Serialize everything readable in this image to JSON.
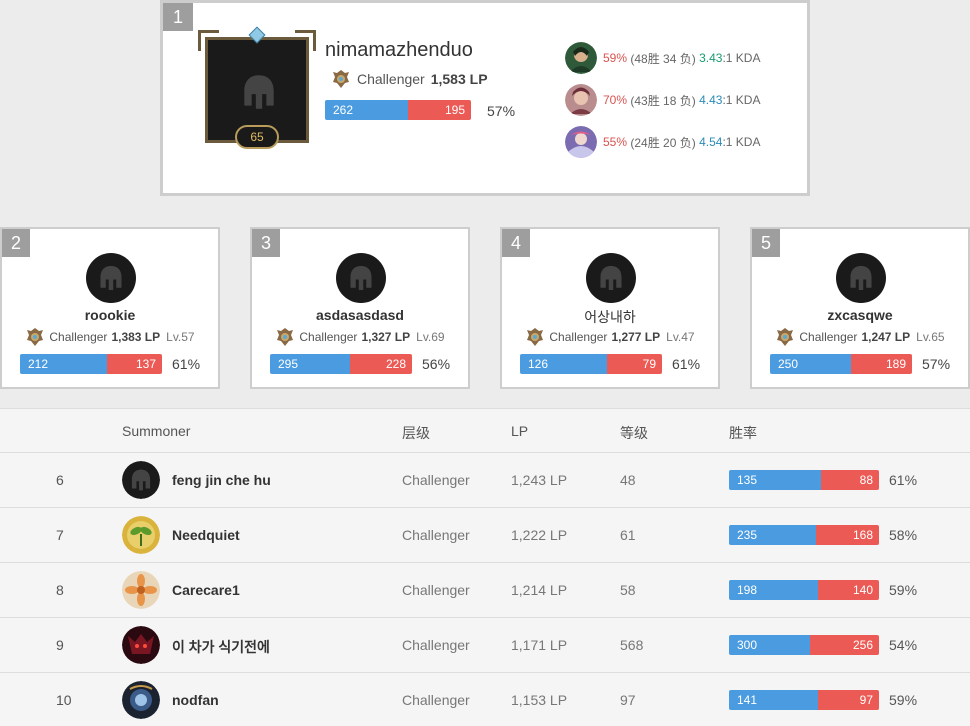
{
  "top": {
    "rank": "1",
    "name": "nimamazhenduo",
    "tier": "Challenger",
    "lp": "1,583 LP",
    "level": "65",
    "wins": "262",
    "losses": "195",
    "win_fraction": 0.57,
    "win_rate": "57%",
    "champions": [
      {
        "wr": "59%",
        "record": "(48胜 34 负)",
        "kda_num": "3.43",
        "kda_suffix": ":1 KDA",
        "kda_color": "#1a9c6b"
      },
      {
        "wr": "70%",
        "record": "(43胜 18 负)",
        "kda_num": "4.43",
        "kda_suffix": ":1 KDA",
        "kda_color": "#2a8ab8"
      },
      {
        "wr": "55%",
        "record": "(24胜 20 负)",
        "kda_num": "4.54",
        "kda_suffix": ":1 KDA",
        "kda_color": "#2a8ab8"
      }
    ]
  },
  "cards": [
    {
      "rank": "2",
      "name": "roookie",
      "tier": "Challenger",
      "lp": "1,383 LP",
      "lv": "Lv.57",
      "wins": "212",
      "losses": "137",
      "win_fraction": 0.61,
      "win_rate": "61%"
    },
    {
      "rank": "3",
      "name": "asdasasdasd",
      "tier": "Challenger",
      "lp": "1,327 LP",
      "lv": "Lv.69",
      "wins": "295",
      "losses": "228",
      "win_fraction": 0.56,
      "win_rate": "56%"
    },
    {
      "rank": "4",
      "name": "어상내하",
      "tier": "Challenger",
      "lp": "1,277 LP",
      "lv": "Lv.47",
      "wins": "126",
      "losses": "79",
      "win_fraction": 0.61,
      "win_rate": "61%"
    },
    {
      "rank": "5",
      "name": "zxcasqwe",
      "tier": "Challenger",
      "lp": "1,247 LP",
      "lv": "Lv.65",
      "wins": "250",
      "losses": "189",
      "win_fraction": 0.57,
      "win_rate": "57%"
    }
  ],
  "table": {
    "headers": {
      "summoner": "Summoner",
      "tier": "层级",
      "lp": "LP",
      "level": "等级",
      "winrate": "胜率"
    },
    "rows": [
      {
        "rank": "6",
        "name": "feng jin che hu",
        "tier": "Challenger",
        "lp": "1,243 LP",
        "level": "48",
        "wins": "135",
        "losses": "88",
        "win_fraction": 0.61,
        "win_rate": "61%",
        "avatar": "helmet-icon"
      },
      {
        "rank": "7",
        "name": "Needquiet",
        "tier": "Challenger",
        "lp": "1,222 LP",
        "level": "61",
        "wins": "235",
        "losses": "168",
        "win_fraction": 0.58,
        "win_rate": "58%",
        "avatar": "sprout-icon"
      },
      {
        "rank": "8",
        "name": "Carecare1",
        "tier": "Challenger",
        "lp": "1,214 LP",
        "level": "58",
        "wins": "198",
        "losses": "140",
        "win_fraction": 0.59,
        "win_rate": "59%",
        "avatar": "flower-icon"
      },
      {
        "rank": "9",
        "name": "이 차가 식기전에",
        "tier": "Challenger",
        "lp": "1,171 LP",
        "level": "568",
        "wins": "300",
        "losses": "256",
        "win_fraction": 0.54,
        "win_rate": "54%",
        "avatar": "demon-icon"
      },
      {
        "rank": "10",
        "name": "nodfan",
        "tier": "Challenger",
        "lp": "1,153 LP",
        "level": "97",
        "wins": "141",
        "losses": "97",
        "win_fraction": 0.59,
        "win_rate": "59%",
        "avatar": "orb-icon"
      }
    ]
  },
  "colors": {
    "win": "#4b9be0",
    "loss": "#ec5a55",
    "badge": "#9e9e9e"
  }
}
